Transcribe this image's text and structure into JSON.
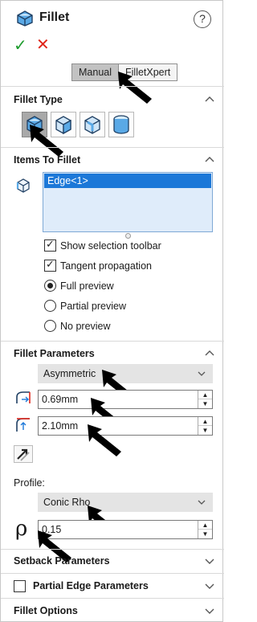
{
  "header": {
    "title": "Fillet",
    "help": "?"
  },
  "actions": {
    "ok": "✓",
    "cancel": "✕"
  },
  "mode": {
    "manual": "Manual",
    "filletxpert": "FilletXpert"
  },
  "sections": {
    "fillet_type": "Fillet Type",
    "items_to_fillet": "Items To Fillet",
    "fillet_parameters": "Fillet Parameters",
    "setback_parameters": "Setback Parameters",
    "partial_edge_parameters": "Partial Edge Parameters",
    "fillet_options": "Fillet Options"
  },
  "items": {
    "list": [
      "Edge<1>"
    ]
  },
  "options": {
    "show_selection_toolbar": "Show selection toolbar",
    "tangent_propagation": "Tangent propagation",
    "full_preview": "Full preview",
    "partial_preview": "Partial preview",
    "no_preview": "No preview"
  },
  "params": {
    "method": "Asymmetric",
    "distance1": "0.69mm",
    "distance2": "2.10mm",
    "profile_label": "Profile:",
    "profile": "Conic Rho",
    "rho_symbol": "ρ",
    "rho": "0.15"
  },
  "colors": {
    "accent_blue": "#1c78d8",
    "list_bg": "#dfecfa",
    "ok_green": "#1e9c2e",
    "cancel_red": "#e0261b"
  },
  "icons": [
    "fillet-feature-icon",
    "help-icon",
    "chevron-up-icon",
    "chevron-down-icon",
    "edge-cube-icon",
    "distance-icon",
    "flip-direction-icon",
    "rho-icon"
  ]
}
